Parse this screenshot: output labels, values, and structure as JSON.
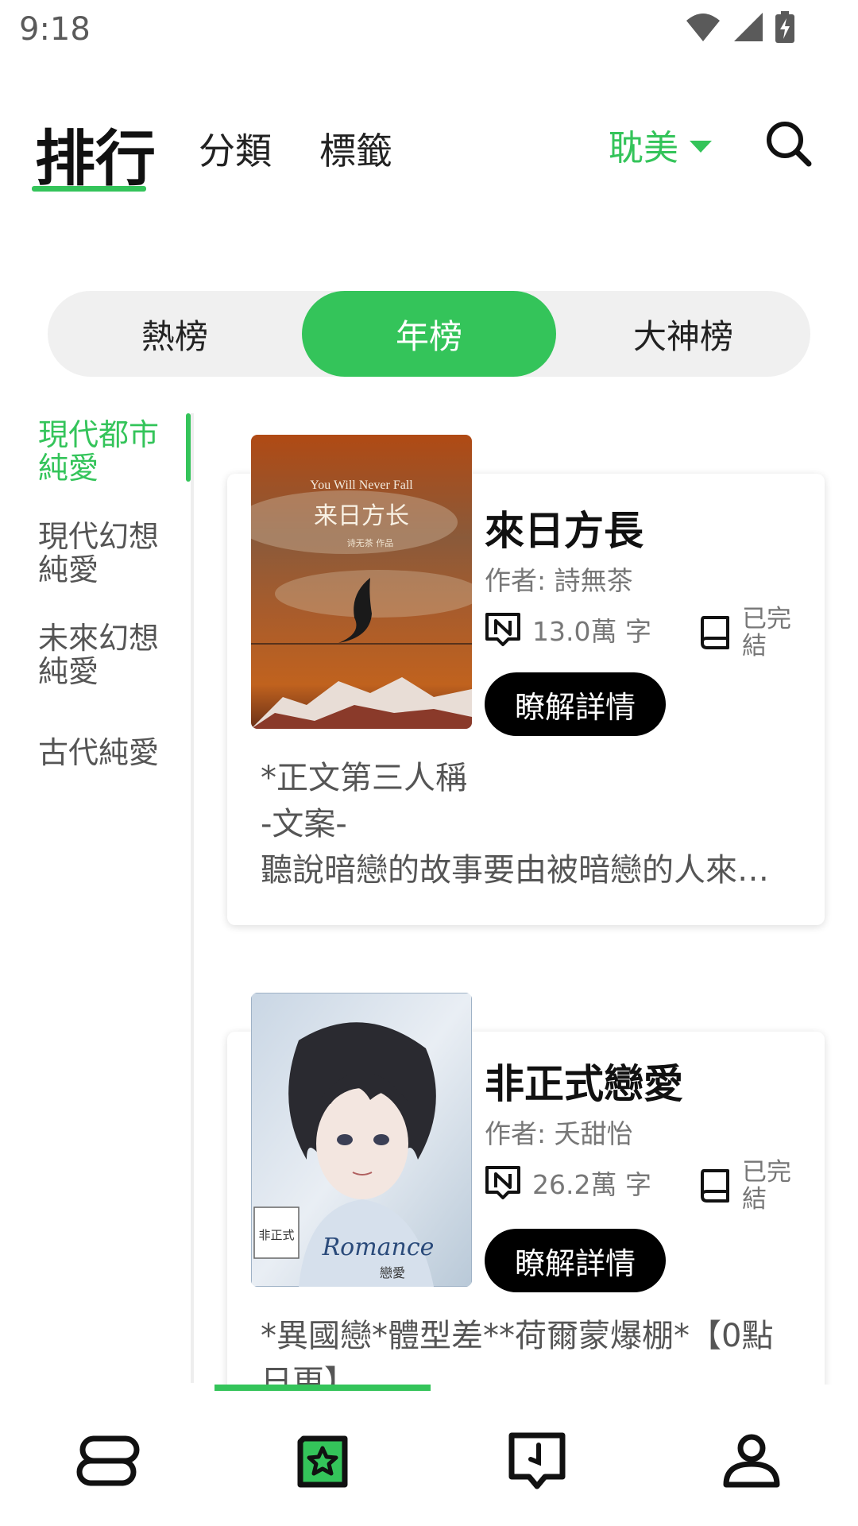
{
  "status_bar": {
    "time": "9:18",
    "icons": [
      "wifi-icon",
      "signal-icon",
      "battery-charging-icon"
    ]
  },
  "top_nav": {
    "tabs": [
      {
        "label": "排行",
        "active": true
      },
      {
        "label": "分類",
        "active": false
      },
      {
        "label": "標籤",
        "active": false
      }
    ],
    "genre": "耽美",
    "accent_color": "#34c45a"
  },
  "segment": {
    "items": [
      {
        "label": "熱榜",
        "active": false
      },
      {
        "label": "年榜",
        "active": true
      },
      {
        "label": "大神榜",
        "active": false
      }
    ]
  },
  "categories": {
    "items": [
      {
        "label": "現代都市純愛",
        "active": true
      },
      {
        "label": "現代幻想純愛",
        "active": false
      },
      {
        "label": "未來幻想純愛",
        "active": false
      },
      {
        "label": "古代純愛",
        "active": false
      }
    ]
  },
  "books": [
    {
      "title": "來日方長",
      "author": "作者: 詩無茶",
      "words": "13.0萬 字",
      "status": "已完結",
      "button": "瞭解詳情",
      "cover": {
        "title_en": "You Will Never Fall",
        "title_cn": "来日方长",
        "subtitle": "诗无茶 作品"
      },
      "description": [
        "*正文第三人稱",
        "-文案-",
        "聽說暗戀的故事要由被暗戀的人來…"
      ]
    },
    {
      "title": "非正式戀愛",
      "author": "作者: 夭甜怡",
      "words": "26.2萬 字",
      "status": "已完結",
      "button": "瞭解詳情",
      "cover": {
        "title_cn": "非正式",
        "title_en": "Romance",
        "subtitle": "戀愛"
      },
      "description": [
        "*異國戀*體型差**荷爾蒙爆棚*【0點",
        "日更】"
      ]
    }
  ],
  "bottom_nav": {
    "items": [
      {
        "icon": "bookshelf-icon",
        "active": false
      },
      {
        "icon": "ranking-star-icon",
        "active": true
      },
      {
        "icon": "bookmark-book-icon",
        "active": false
      },
      {
        "icon": "profile-icon",
        "active": false
      }
    ]
  }
}
